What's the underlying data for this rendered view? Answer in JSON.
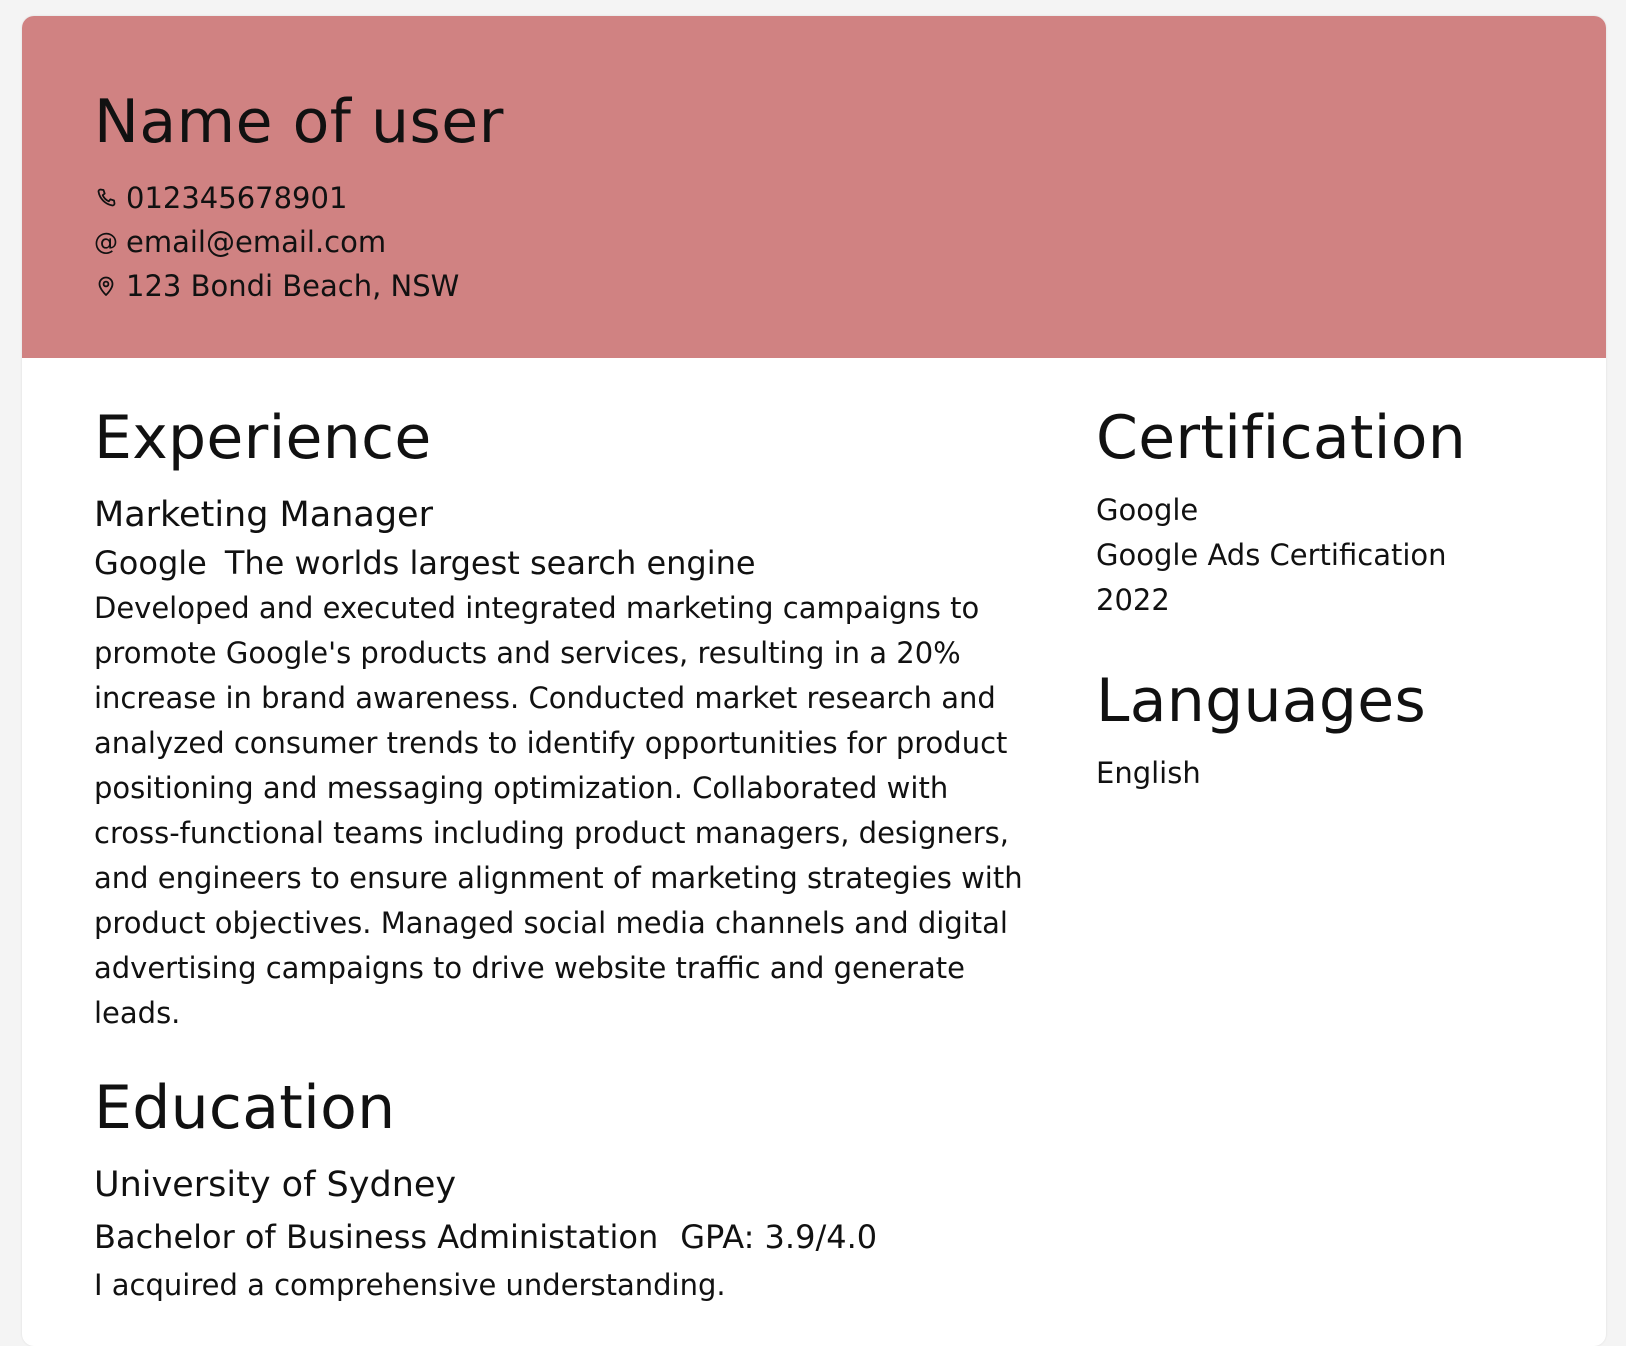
{
  "header": {
    "name": "Name of user",
    "phone": "012345678901",
    "email": "email@email.com",
    "address": "123 Bondi Beach, NSW",
    "email_symbol": "@",
    "background": "#d08282"
  },
  "experience": {
    "title": "Experience",
    "job_title": "Marketing Manager",
    "company": "Google",
    "company_tagline": "The worlds largest search engine",
    "description": "Developed and executed integrated marketing campaigns to promote Google's products and services, resulting in a 20% increase in brand awareness. Conducted market research and analyzed consumer trends to identify opportunities for product positioning and messaging optimization. Collaborated with cross-functional teams including product managers, designers, and engineers to ensure alignment of marketing strategies with product objectives. Managed social media channels and digital advertising campaigns to drive website traffic and generate leads."
  },
  "education": {
    "title": "Education",
    "school": "University of Sydney",
    "degree": "Bachelor of Business Administation",
    "gpa": "GPA: 3.9/4.0",
    "description": "I acquired a comprehensive understanding."
  },
  "certification": {
    "title": "Certification",
    "issuer": "Google",
    "name": "Google Ads Certification",
    "year": "2022"
  },
  "languages": {
    "title": "Languages",
    "items": [
      "English"
    ]
  },
  "icons": {
    "phone": "phone-icon",
    "email": "at-icon",
    "address": "location-pin-icon"
  }
}
